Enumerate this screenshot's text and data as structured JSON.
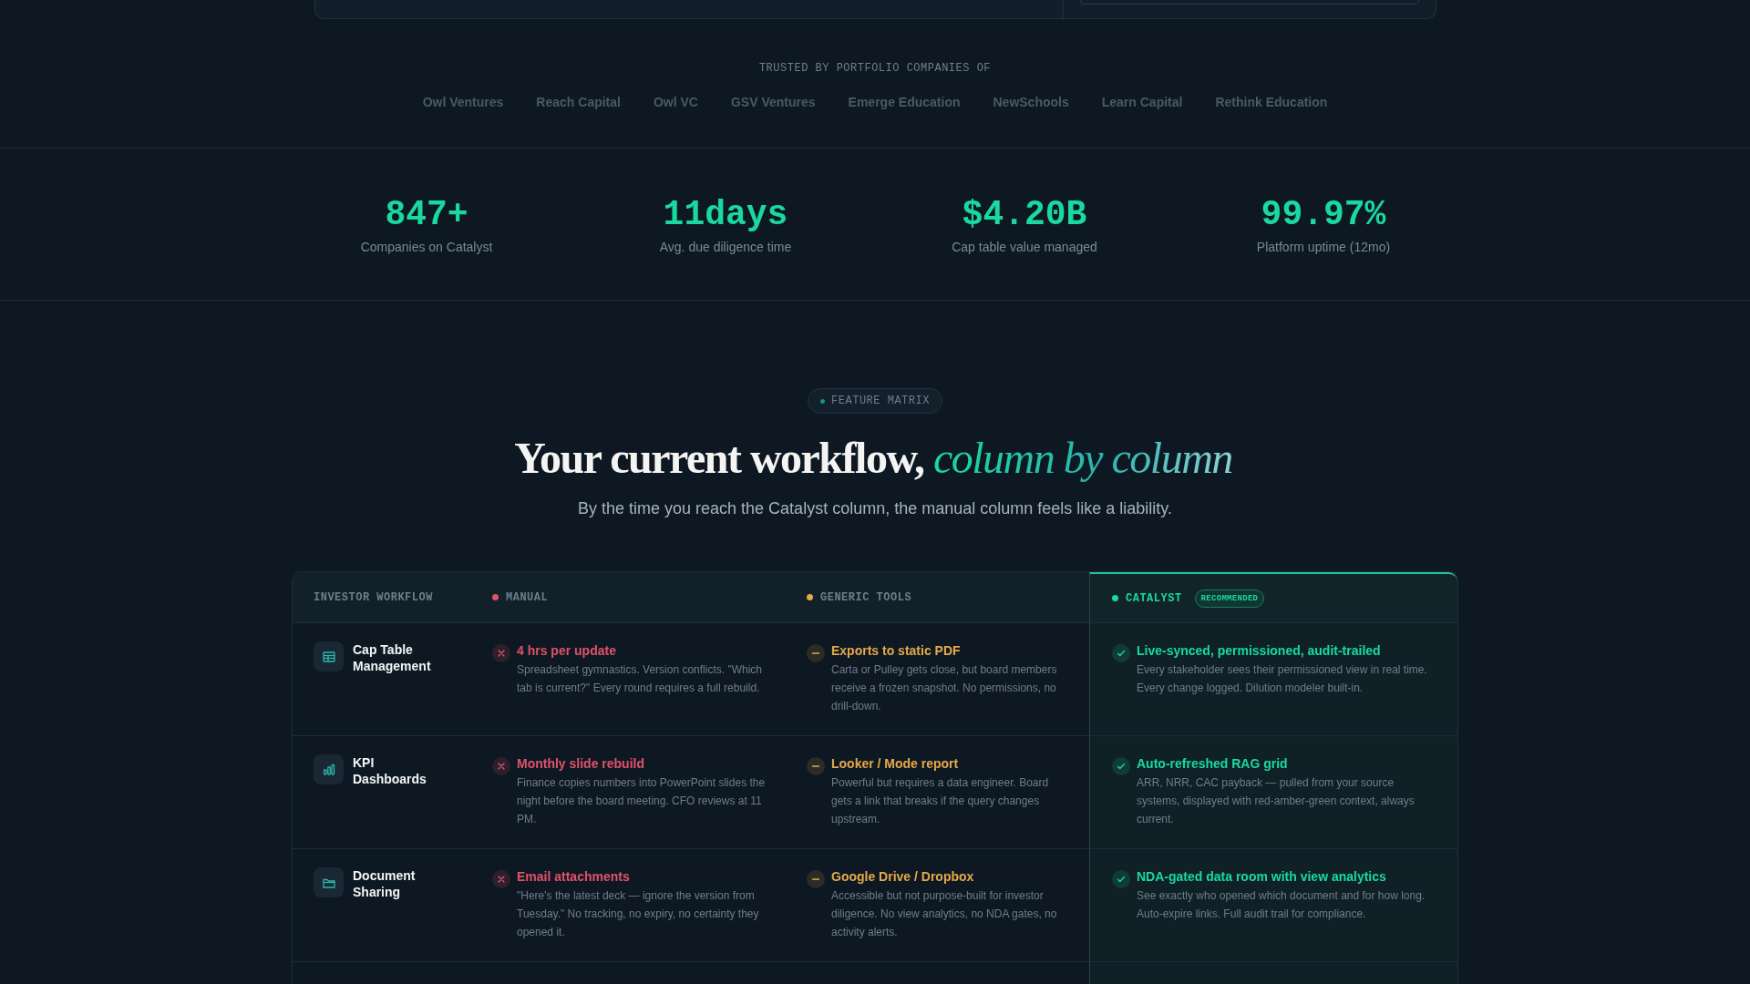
{
  "trusted": {
    "label": "TRUSTED BY PORTFOLIO COMPANIES OF",
    "logos": [
      "Owl Ventures",
      "Reach Capital",
      "Owl VC",
      "GSV Ventures",
      "Emerge Education",
      "NewSchools",
      "Learn Capital",
      "Rethink Education"
    ]
  },
  "stats": [
    {
      "value": "847+",
      "label": "Companies on Catalyst"
    },
    {
      "value": "11days",
      "label": "Avg. due diligence time"
    },
    {
      "value": "$4.20B",
      "label": "Cap table value managed"
    },
    {
      "value": "99.97%",
      "label": "Platform uptime (12mo)"
    }
  ],
  "section": {
    "badge": "FEATURE MATRIX",
    "heading": "Your current workflow, *column by column*",
    "subtitle": "By the time you reach the Catalyst column, the manual column feels like a liability."
  },
  "table": {
    "columns": [
      {
        "label": "INVESTOR WORKFLOW",
        "kind": "label"
      },
      {
        "label": "MANUAL",
        "kind": "manual",
        "color": "#e0526b"
      },
      {
        "label": "GENERIC TOOLS",
        "kind": "generic",
        "color": "#e5a94a"
      },
      {
        "label": "CATALYST",
        "kind": "catalyst",
        "color": "#19d9a0",
        "badge": "RECOMMENDED"
      }
    ],
    "rows": [
      {
        "cells": [
          {
            "kind": "workflow",
            "title": "Cap Table Management"
          },
          {
            "kind": "bad",
            "title": "4 hrs per update",
            "text": "Spreadsheet gymnastics. Version conflicts. \"Which tab is current?\" Every round requires a full rebuild."
          },
          {
            "kind": "partial",
            "title": "Exports to static PDF",
            "text": "Carta or Pulley gets close, but board members receive a frozen snapshot. No permissions, no drill-down."
          },
          {
            "kind": "good",
            "title": "Live-synced, permissioned, audit-trailed",
            "text": "Every stakeholder sees their permissioned view in real time. Every change logged. Dilution modeler built-in."
          }
        ]
      },
      {
        "cells": [
          {
            "kind": "workflow",
            "title": "KPI Dashboards"
          },
          {
            "kind": "bad",
            "title": "Monthly slide rebuild",
            "text": "Finance copies numbers into PowerPoint slides the night before the board meeting. CFO reviews at 11 PM."
          },
          {
            "kind": "partial",
            "title": "Looker / Mode report",
            "text": "Powerful but requires a data engineer. Board gets a link that breaks if the query changes upstream."
          },
          {
            "kind": "good",
            "title": "Auto-refreshed RAG grid",
            "text": "ARR, NRR, CAC payback — pulled from your source systems, displayed with red-amber-green context, always current."
          }
        ]
      },
      {
        "cells": [
          {
            "kind": "workflow",
            "title": "Document Sharing"
          },
          {
            "kind": "bad",
            "title": "Email attachments",
            "text": "\"Here's the latest deck — ignore the version from Tuesday.\" No tracking, no expiry, no certainty they opened it."
          },
          {
            "kind": "partial",
            "title": "Google Drive / Dropbox",
            "text": "Accessible but not purpose-built for investor diligence. No view analytics, no NDA gates, no activity alerts."
          },
          {
            "kind": "good",
            "title": "NDA-gated data room with view analytics",
            "text": "See exactly who opened which document and for how long. Auto-expire links. Full audit trail for compliance."
          }
        ]
      }
    ]
  }
}
